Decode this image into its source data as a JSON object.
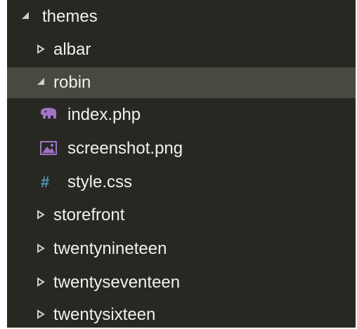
{
  "explorer": {
    "root": {
      "label": "themes",
      "expanded": true
    },
    "items": [
      {
        "label": "albar",
        "type": "folder",
        "expanded": false
      },
      {
        "label": "robin",
        "type": "folder",
        "expanded": true,
        "selected": true
      },
      {
        "label": "index.php",
        "type": "file",
        "icon": "php-elephant-icon",
        "icon_color": "#a074c4"
      },
      {
        "label": "screenshot.png",
        "type": "file",
        "icon": "image-icon",
        "icon_color": "#a074c4"
      },
      {
        "label": "style.css",
        "type": "file",
        "icon": "hash-icon",
        "icon_glyph": "#",
        "icon_color": "#519aba"
      },
      {
        "label": "storefront",
        "type": "folder",
        "expanded": false
      },
      {
        "label": "twentynineteen",
        "type": "folder",
        "expanded": false
      },
      {
        "label": "twentyseventeen",
        "type": "folder",
        "expanded": false
      },
      {
        "label": "twentysixteen",
        "type": "folder",
        "expanded": false
      }
    ]
  },
  "colors": {
    "background": "#272822",
    "selected_row": "#484941",
    "text": "#f1f1ea",
    "php_icon": "#a074c4",
    "css_icon": "#519aba"
  }
}
